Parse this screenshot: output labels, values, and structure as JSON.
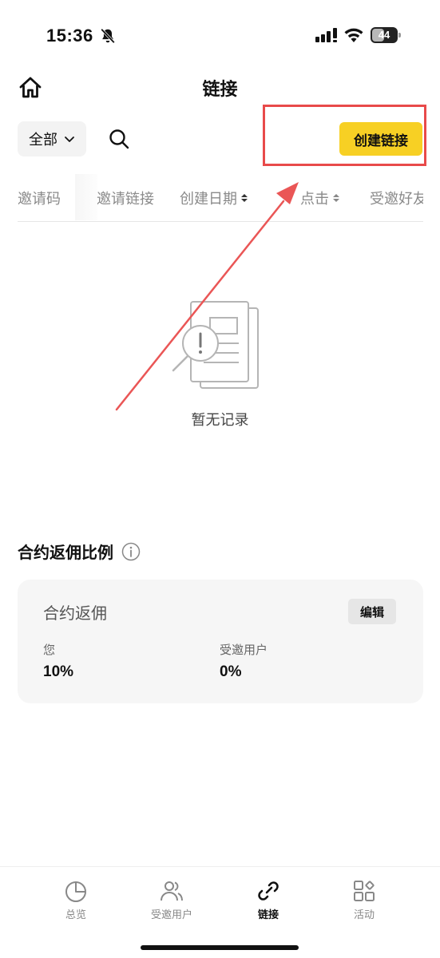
{
  "status_bar": {
    "time": "15:36",
    "battery_level": "44",
    "icons": [
      "bell-slash-icon",
      "signal-icon",
      "wifi-icon",
      "battery-icon"
    ]
  },
  "header": {
    "title": "链接",
    "home_icon": "home-icon"
  },
  "toolbar": {
    "filter_value": "全部",
    "search_icon": "search-icon",
    "create_button_label": "创建链接"
  },
  "table": {
    "columns": [
      {
        "label": "邀请码",
        "sortable": false
      },
      {
        "label": "邀请链接",
        "sortable": false
      },
      {
        "label": "创建日期",
        "sortable": true
      },
      {
        "label": "点击",
        "sortable": true
      },
      {
        "label": "受邀好友",
        "sortable": false
      }
    ],
    "rows": []
  },
  "empty_state": {
    "message": "暂无记录",
    "icon": "no-records-icon"
  },
  "rebate_section": {
    "title": "合约返佣比例",
    "info_icon": "info-icon",
    "card": {
      "title": "合约返佣",
      "edit_label": "编辑",
      "you_label": "您",
      "you_value": "10%",
      "invitee_label": "受邀用户",
      "invitee_value": "0%"
    }
  },
  "tab_bar": {
    "items": [
      {
        "label": "总览",
        "icon": "pie-chart-icon",
        "active": false
      },
      {
        "label": "受邀用户",
        "icon": "users-icon",
        "active": false
      },
      {
        "label": "链接",
        "icon": "link-icon",
        "active": true
      },
      {
        "label": "活动",
        "icon": "apps-grid-icon",
        "active": false
      }
    ]
  },
  "colors": {
    "accent_yellow": "#f7d024",
    "annotation_red": "#e84a4a",
    "card_background": "#f6f6f6"
  }
}
